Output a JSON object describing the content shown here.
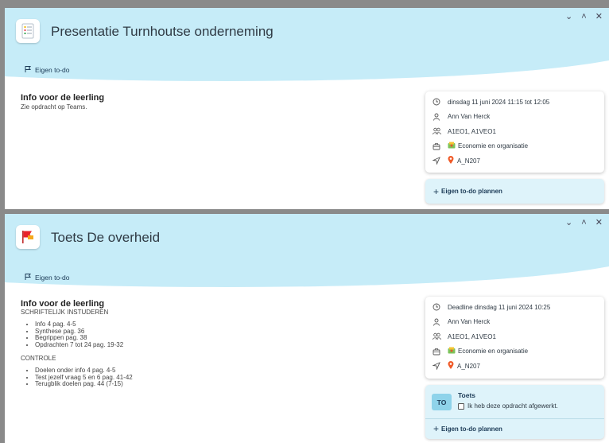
{
  "window_controls": {
    "collapse": "⌄",
    "expand": "˄",
    "close": "✕"
  },
  "panel1": {
    "title": "Presentatie Turnhoutse onderneming",
    "todo_label": "Eigen to-do",
    "info_title": "Info voor de leerling",
    "info_text": "Zie opdracht op Teams.",
    "details": {
      "time": "dinsdag 11 juni 2024 11:15 tot 12:05",
      "teacher": "Ann Van Herck",
      "groups": "A1EO1, A1VEO1",
      "course": "Economie en organisatie",
      "location": "A_N207"
    },
    "plan_label": "Eigen to-do plannen"
  },
  "panel2": {
    "title": "Toets De overheid",
    "todo_label": "Eigen to-do",
    "info_title": "Info voor de leerling",
    "section1_heading": "SCHRIFTELIJK INSTUDEREN",
    "section1_items": [
      "Info 4 pag. 4-5",
      "Synthese pag. 36",
      "Begrippen pag. 38",
      "Opdrachten 7 tot 24 pag. 19-32"
    ],
    "section2_heading": "CONTROLE",
    "section2_items": [
      "Doelen onder info 4 pag. 4-5",
      "Test jezelf vraag 5 en 6 pag. 41-42",
      "Terugblik doelen pag. 44 (7-15)"
    ],
    "details": {
      "time": "Deadline dinsdag 11 juni 2024 10:25",
      "teacher": "Ann Van Herck",
      "groups": "A1EO1, A1VEO1",
      "course": "Economie en organisatie",
      "location": "A_N207"
    },
    "task_badge": "TO",
    "task_title": "Toets",
    "task_checkbox_label": "Ik heb deze opdracht afgewerkt.",
    "plan_label": "Eigen to-do plannen"
  },
  "colors": {
    "header": "#c6ecf8",
    "accent": "#1c3b57",
    "pin": "#f05a28",
    "plan_bg": "#def3fa"
  }
}
